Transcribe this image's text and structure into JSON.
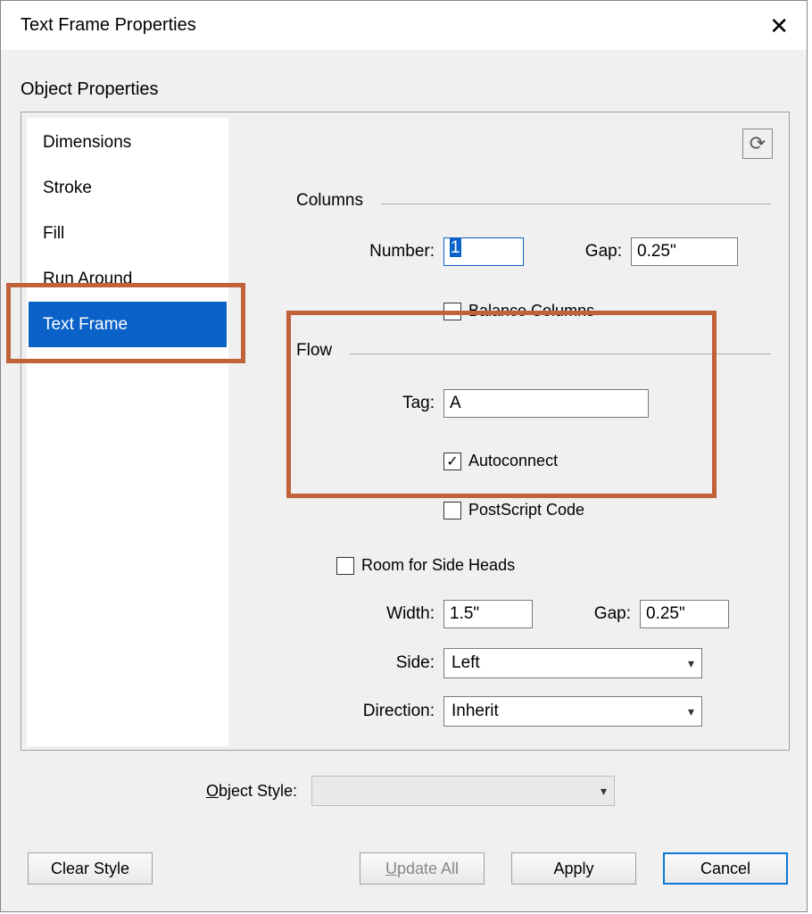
{
  "dialog_title": "Text Frame Properties",
  "section_label": "Object Properties",
  "tabs": {
    "dimensions": "Dimensions",
    "stroke": "Stroke",
    "fill": "Fill",
    "run_around": "Run Around",
    "text_frame": "Text Frame"
  },
  "columns": {
    "group_label": "Columns",
    "number_label": "Number:",
    "number_value": "1",
    "gap_label": "Gap:",
    "gap_value": "0.25\"",
    "balance_label": "Balance Columns"
  },
  "flow": {
    "group_label": "Flow",
    "tag_label": "Tag:",
    "tag_value": "A",
    "autoconnect_label": "Autoconnect",
    "postscript_label": "PostScript Code"
  },
  "sideheads": {
    "label": "Room for Side Heads",
    "width_label": "Width:",
    "width_value": "1.5\"",
    "gap_label": "Gap:",
    "gap_value": "0.25\"",
    "side_label": "Side:",
    "side_value": "Left",
    "direction_label": "Direction:",
    "direction_value": "Inherit"
  },
  "object_style_label": "Object Style:",
  "buttons": {
    "clear_style": "Clear Style",
    "update_all": "Update All",
    "apply": "Apply",
    "cancel": "Cancel"
  }
}
